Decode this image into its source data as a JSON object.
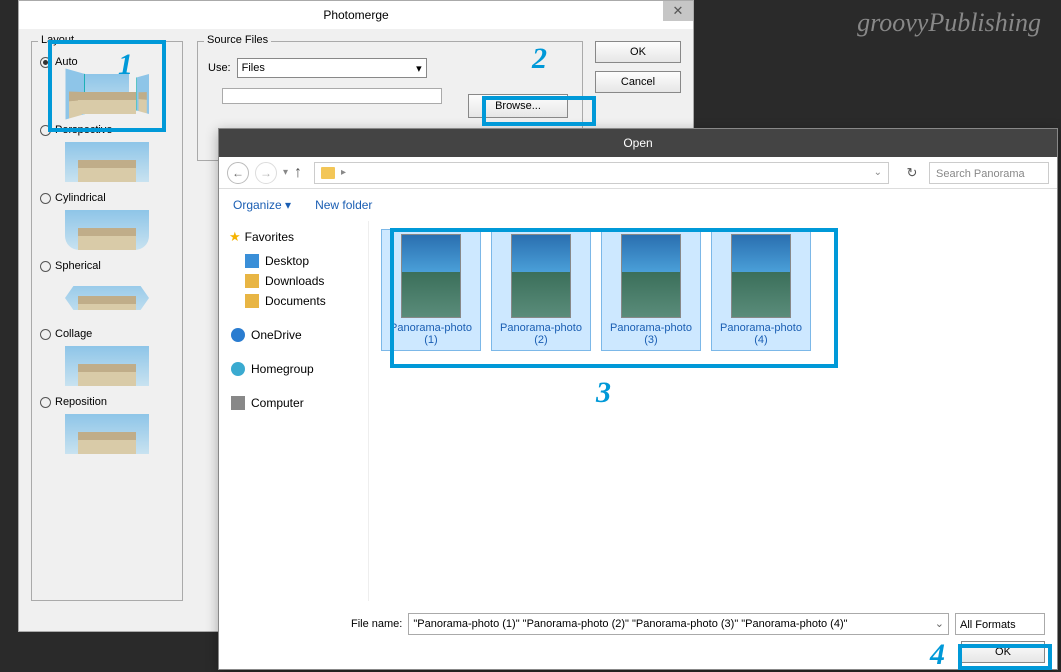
{
  "watermark": "groovyPublishing",
  "photomerge": {
    "title": "Photomerge",
    "layout_legend": "Layout",
    "options": {
      "auto": "Auto",
      "perspective": "Perspective",
      "cylindrical": "Cylindrical",
      "spherical": "Spherical",
      "collage": "Collage",
      "reposition": "Reposition"
    },
    "selected": "auto",
    "source_legend": "Source Files",
    "use_label": "Use:",
    "use_value": "Files",
    "browse": "Browse...",
    "ok": "OK",
    "cancel": "Cancel"
  },
  "open": {
    "title": "Open",
    "organize": "Organize ▾",
    "new_folder": "New folder",
    "search_placeholder": "Search Panorama",
    "sidebar": {
      "favorites": "Favorites",
      "desktop": "Desktop",
      "downloads": "Downloads",
      "documents": "Documents",
      "onedrive": "OneDrive",
      "homegroup": "Homegroup",
      "computer": "Computer"
    },
    "files": [
      {
        "name": "Panorama-photo (1)"
      },
      {
        "name": "Panorama-photo (2)"
      },
      {
        "name": "Panorama-photo (3)"
      },
      {
        "name": "Panorama-photo (4)"
      }
    ],
    "filename_label": "File name:",
    "filename_value": "\"Panorama-photo (1)\" \"Panorama-photo (2)\" \"Panorama-photo (3)\" \"Panorama-photo (4)\"",
    "filter": "All Formats",
    "ok": "OK"
  },
  "annotations": {
    "n1": "1",
    "n2": "2",
    "n3": "3",
    "n4": "4"
  }
}
